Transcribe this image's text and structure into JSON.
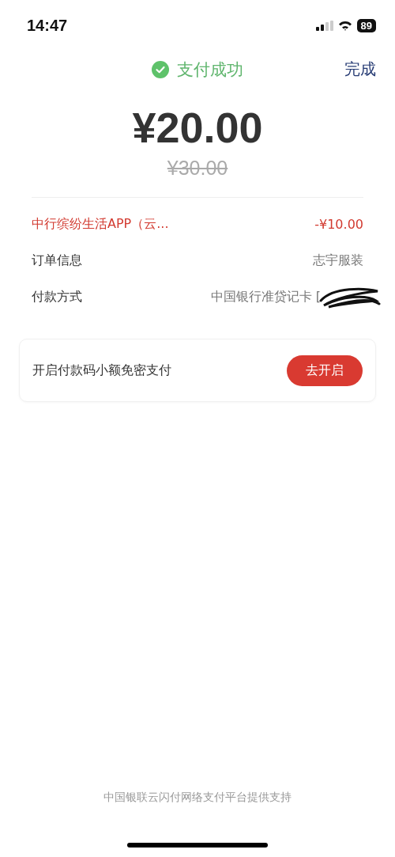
{
  "status_bar": {
    "time": "14:47",
    "battery": "89"
  },
  "header": {
    "title": "支付成功",
    "done": "完成"
  },
  "amount": {
    "paid": "¥20.00",
    "original": "¥30.00"
  },
  "details": [
    {
      "kind": "discount",
      "label": "中行缤纷生活APP（云...",
      "value": "-¥10.00"
    },
    {
      "kind": "plain",
      "label": "订单信息",
      "value": "志宇服装"
    },
    {
      "kind": "redacted",
      "label": "付款方式",
      "value": "中国银行准贷记卡 ["
    }
  ],
  "promo": {
    "text": "开启付款码小额免密支付",
    "button": "去开启"
  },
  "footer": "中国银联云闪付网络支付平台提供支持"
}
